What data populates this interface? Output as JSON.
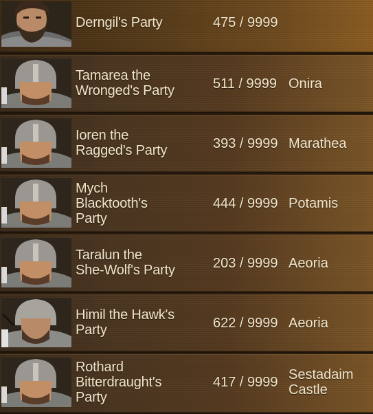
{
  "parties": [
    {
      "name": "Derngil's Party",
      "size": "475 / 9999",
      "location": "",
      "portrait": "bare-head-bearded-lord-portrait"
    },
    {
      "name": "Tamarea the\nWronged's Party",
      "size": "511 / 9999",
      "location": "Onira",
      "portrait": "helmeted-soldier-portrait"
    },
    {
      "name": "Ioren the\nRagged's Party",
      "size": "393 / 9999",
      "location": "Marathea",
      "portrait": "helmeted-soldier-portrait"
    },
    {
      "name": "Mych\nBlacktooth's\nParty",
      "size": "444 / 9999",
      "location": "Potamis",
      "portrait": "helmeted-soldier-portrait"
    },
    {
      "name": "Taralun the\nShe-Wolf's Party",
      "size": "203 / 9999",
      "location": "Aeoria",
      "portrait": "helmeted-soldier-portrait"
    },
    {
      "name": "Himil the Hawk's\nParty",
      "size": "622 / 9999",
      "location": "Aeoria",
      "portrait": "helmeted-bearded-soldier-portrait"
    },
    {
      "name": "Rothard\nBitterdraught's\nParty",
      "size": "417 / 9999",
      "location": "Sestadaim\nCastle",
      "portrait": "helmeted-soldier-portrait"
    }
  ]
}
